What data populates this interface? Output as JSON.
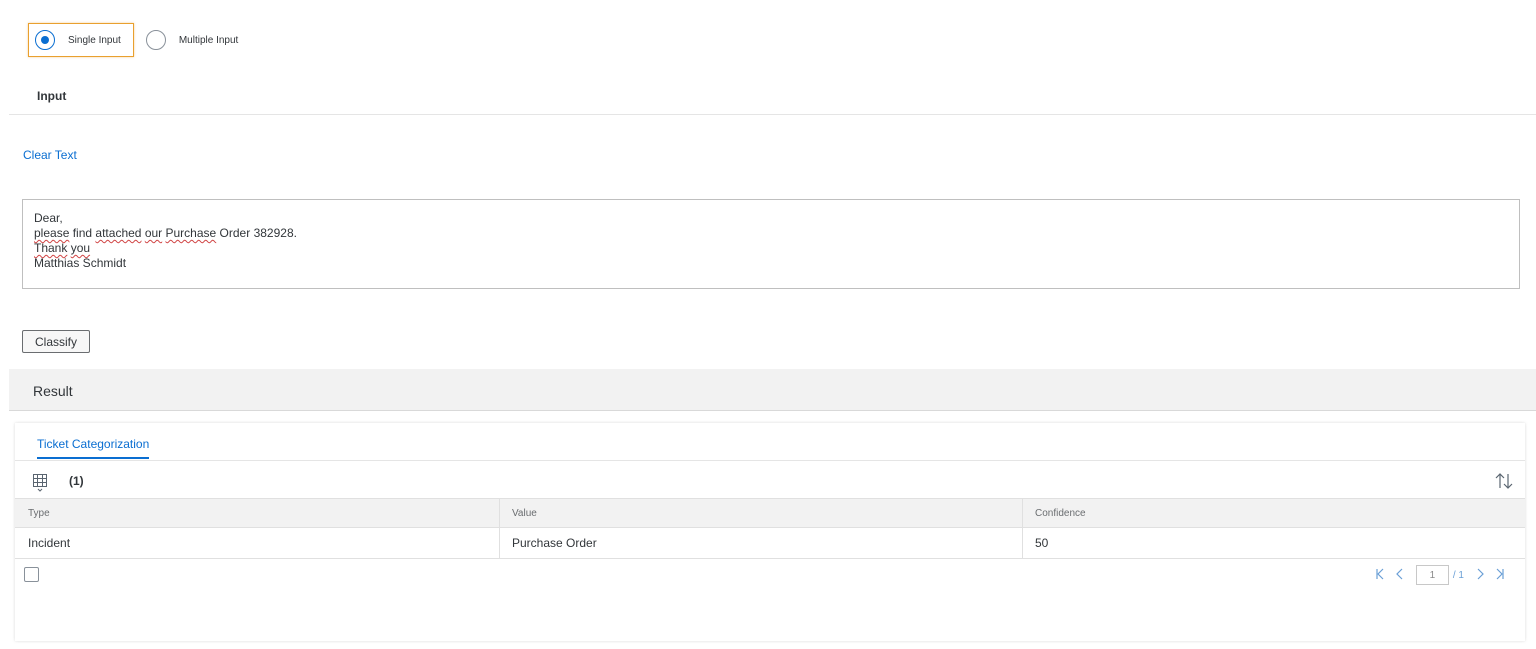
{
  "input_mode": {
    "options": [
      {
        "label": "Single Input",
        "selected": true
      },
      {
        "label": "Multiple Input",
        "selected": false
      }
    ]
  },
  "input_section": {
    "title": "Input",
    "clear_link": "Clear Text",
    "textarea_lines": [
      "Dear,",
      "please find attached our Purchase Order 382928.",
      "Thank you",
      "Matthias Schmidt"
    ],
    "classify_button": "Classify"
  },
  "result_section": {
    "title": "Result",
    "tab_label": "Ticket Categorization",
    "count": "(1)",
    "table": {
      "columns": [
        "Type",
        "Value",
        "Confidence"
      ],
      "rows": [
        [
          "Incident",
          "Purchase Order",
          "50"
        ]
      ]
    },
    "pagination": {
      "current_page": "1",
      "total": "/ 1"
    }
  },
  "icons": {
    "table_settings": "table-view-icon",
    "sort": "sort-icon",
    "first_page": "first-page-icon",
    "prev_page": "previous-page-icon",
    "next_page": "next-page-icon",
    "last_page": "last-page-icon"
  },
  "colors": {
    "accent": "#0a6ed1",
    "focus": "#e9a02f"
  }
}
